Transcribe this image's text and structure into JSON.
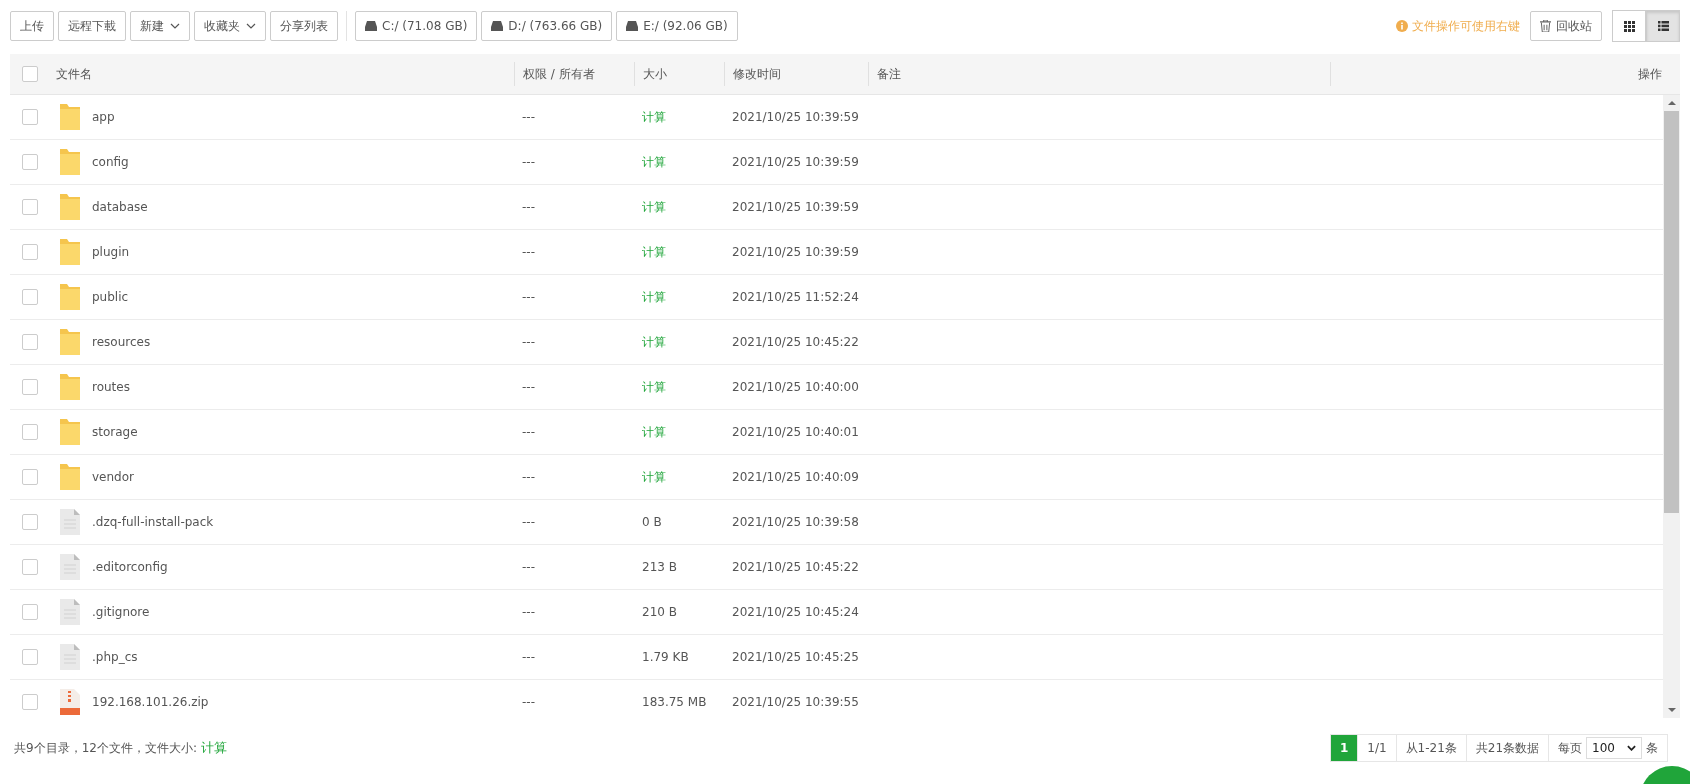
{
  "toolbar": {
    "buttons": [
      {
        "label": "上传",
        "kind": "plain"
      },
      {
        "label": "远程下載",
        "kind": "plain"
      },
      {
        "label": "新建",
        "kind": "dropdown"
      },
      {
        "label": "收藏夹",
        "kind": "dropdown"
      },
      {
        "label": "分享列表",
        "kind": "plain"
      }
    ],
    "drives": [
      {
        "label": "C:/ (71.08 GB)"
      },
      {
        "label": "D:/ (763.66 GB)"
      },
      {
        "label": "E:/ (92.06 GB)"
      }
    ],
    "hint": "文件操作可使用右键",
    "recycle": "回收站",
    "views": [
      {
        "kind": "grid",
        "selected": false
      },
      {
        "kind": "list",
        "selected": true
      }
    ]
  },
  "table": {
    "select_all": {
      "checked": false
    },
    "columns": [
      "文件名",
      "权限 / 所有者",
      "大小",
      "修改时间",
      "备注",
      "操作"
    ],
    "rows": [
      {
        "name": "app",
        "kind": "folder",
        "owner": "---",
        "size": "计算",
        "size_is_action": true,
        "modified": "2021/10/25 10:39:59",
        "checked": false
      },
      {
        "name": "config",
        "kind": "folder",
        "owner": "---",
        "size": "计算",
        "size_is_action": true,
        "modified": "2021/10/25 10:39:59",
        "checked": false
      },
      {
        "name": "database",
        "kind": "folder",
        "owner": "---",
        "size": "计算",
        "size_is_action": true,
        "modified": "2021/10/25 10:39:59",
        "checked": false
      },
      {
        "name": "plugin",
        "kind": "folder",
        "owner": "---",
        "size": "计算",
        "size_is_action": true,
        "modified": "2021/10/25 10:39:59",
        "checked": false
      },
      {
        "name": "public",
        "kind": "folder",
        "owner": "---",
        "size": "计算",
        "size_is_action": true,
        "modified": "2021/10/25 11:52:24",
        "checked": false
      },
      {
        "name": "resources",
        "kind": "folder",
        "owner": "---",
        "size": "计算",
        "size_is_action": true,
        "modified": "2021/10/25 10:45:22",
        "checked": false
      },
      {
        "name": "routes",
        "kind": "folder",
        "owner": "---",
        "size": "计算",
        "size_is_action": true,
        "modified": "2021/10/25 10:40:00",
        "checked": false
      },
      {
        "name": "storage",
        "kind": "folder",
        "owner": "---",
        "size": "计算",
        "size_is_action": true,
        "modified": "2021/10/25 10:40:01",
        "checked": false
      },
      {
        "name": "vendor",
        "kind": "folder",
        "owner": "---",
        "size": "计算",
        "size_is_action": true,
        "modified": "2021/10/25 10:40:09",
        "checked": false
      },
      {
        "name": ".dzq-full-install-pack",
        "kind": "file",
        "owner": "---",
        "size": "0 B",
        "size_is_action": false,
        "modified": "2021/10/25 10:39:58",
        "checked": false
      },
      {
        "name": ".editorconfig",
        "kind": "file",
        "owner": "---",
        "size": "213 B",
        "size_is_action": false,
        "modified": "2021/10/25 10:45:22",
        "checked": false
      },
      {
        "name": ".gitignore",
        "kind": "file",
        "owner": "---",
        "size": "210 B",
        "size_is_action": false,
        "modified": "2021/10/25 10:45:24",
        "checked": false
      },
      {
        "name": ".php_cs",
        "kind": "file",
        "owner": "---",
        "size": "1.79 KB",
        "size_is_action": false,
        "modified": "2021/10/25 10:45:25",
        "checked": false
      },
      {
        "name": "192.168.101.26.zip",
        "kind": "zip",
        "owner": "---",
        "size": "183.75 MB",
        "size_is_action": false,
        "modified": "2021/10/25 10:39:55",
        "checked": false
      }
    ]
  },
  "footer": {
    "summary": "共9个目录，12个文件，文件大小:",
    "calc_link": "计算"
  },
  "pagination": {
    "pages": [
      {
        "label": "1",
        "selected": true
      }
    ],
    "page_of": "1/1",
    "range": "从1-21条",
    "total": "共21条数据",
    "per_page_label": "每页",
    "per_page": "100",
    "per_page_unit": "条"
  }
}
